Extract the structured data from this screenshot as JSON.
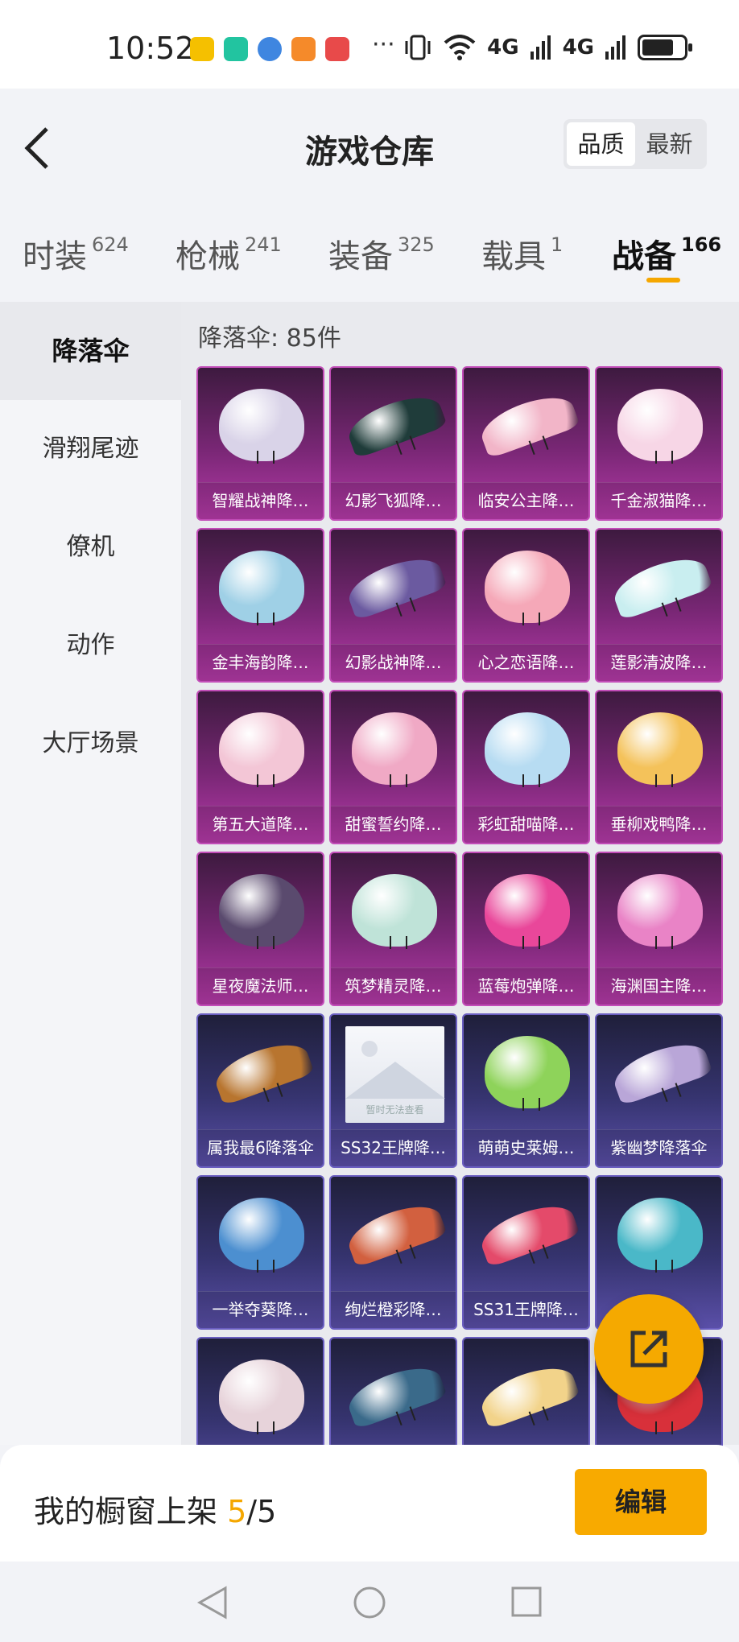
{
  "status_bar": {
    "time": "10:52",
    "dots": "···",
    "signal_1": "4G",
    "signal_2": "4G"
  },
  "header": {
    "title": "游戏仓库",
    "sort_options": [
      "品质",
      "最新"
    ]
  },
  "tabs": [
    {
      "label": "时装",
      "count": "624"
    },
    {
      "label": "枪械",
      "count": "241"
    },
    {
      "label": "装备",
      "count": "325"
    },
    {
      "label": "载具",
      "count": "1"
    },
    {
      "label": "战备",
      "count": "166"
    }
  ],
  "sidebar": [
    "降落伞",
    "滑翔尾迹",
    "僚机",
    "动作",
    "大厅场景"
  ],
  "grid": {
    "count_label": "降落伞: 85件",
    "items": [
      {
        "name": "智耀战神降…",
        "style": "purple",
        "shape": "chute",
        "color": "#d9d3e8"
      },
      {
        "name": "幻影飞狐降…",
        "style": "purple",
        "shape": "glider",
        "color": "#1f3c3a"
      },
      {
        "name": "临安公主降…",
        "style": "purple",
        "shape": "glider",
        "color": "#f2b5c8"
      },
      {
        "name": "千金淑猫降…",
        "style": "purple",
        "shape": "chute",
        "color": "#f7d6e6"
      },
      {
        "name": "金丰海韵降…",
        "style": "purple",
        "shape": "chute",
        "color": "#9fd0e6"
      },
      {
        "name": "幻影战神降…",
        "style": "purple",
        "shape": "glider",
        "color": "#6b5aa0"
      },
      {
        "name": "心之恋语降…",
        "style": "purple",
        "shape": "chute",
        "color": "#f5a8b8"
      },
      {
        "name": "莲影清波降…",
        "style": "purple",
        "shape": "glider",
        "color": "#c9eef0"
      },
      {
        "name": "第五大道降…",
        "style": "purple",
        "shape": "chute",
        "color": "#f3c6d6"
      },
      {
        "name": "甜蜜誓约降…",
        "style": "purple",
        "shape": "chute",
        "color": "#f0a9c5"
      },
      {
        "name": "彩虹甜喵降…",
        "style": "purple",
        "shape": "chute",
        "color": "#b7dcf2"
      },
      {
        "name": "垂柳戏鸭降…",
        "style": "purple",
        "shape": "chute",
        "color": "#f4c25a"
      },
      {
        "name": "星夜魔法师…",
        "style": "purple",
        "shape": "chute",
        "color": "#5a4a6e"
      },
      {
        "name": "筑梦精灵降…",
        "style": "purple",
        "shape": "chute",
        "color": "#bfe3d8"
      },
      {
        "name": "蓝莓炮弹降…",
        "style": "purple",
        "shape": "chute",
        "color": "#e9479a"
      },
      {
        "name": "海渊国主降…",
        "style": "purple",
        "shape": "chute",
        "color": "#e983c6"
      },
      {
        "name": "属我最6降落伞",
        "style": "blue",
        "shape": "glider",
        "color": "#b8752f"
      },
      {
        "name": "SS32王牌降…",
        "style": "blue",
        "shape": "placeholder",
        "color": "#e0e4ec",
        "placeholder_text": "暂时无法查看"
      },
      {
        "name": "萌萌史莱姆…",
        "style": "blue",
        "shape": "chute",
        "color": "#8ed35a"
      },
      {
        "name": "紫幽梦降落伞",
        "style": "blue",
        "shape": "glider",
        "color": "#b9a6d8"
      },
      {
        "name": "一举夺葵降…",
        "style": "blue",
        "shape": "chute",
        "color": "#4c8fd0"
      },
      {
        "name": "绚烂橙彩降…",
        "style": "blue",
        "shape": "glider",
        "color": "#d2603f"
      },
      {
        "name": "SS31王牌降…",
        "style": "blue",
        "shape": "glider",
        "color": "#e44a6a"
      },
      {
        "name": "",
        "style": "blue",
        "shape": "chute",
        "color": "#4ab8c8"
      },
      {
        "name": "",
        "style": "blue",
        "shape": "chute",
        "color": "#e7d3da"
      },
      {
        "name": "",
        "style": "blue",
        "shape": "glider",
        "color": "#3a6a8a"
      },
      {
        "name": "",
        "style": "blue",
        "shape": "glider",
        "color": "#f2d38a"
      },
      {
        "name": "",
        "style": "blue",
        "shape": "chute",
        "color": "#d8303a"
      }
    ]
  },
  "bottom_bar": {
    "label": "我的橱窗上架 ",
    "current": "5",
    "separator": "/",
    "total": "5",
    "edit_button": "编辑"
  }
}
